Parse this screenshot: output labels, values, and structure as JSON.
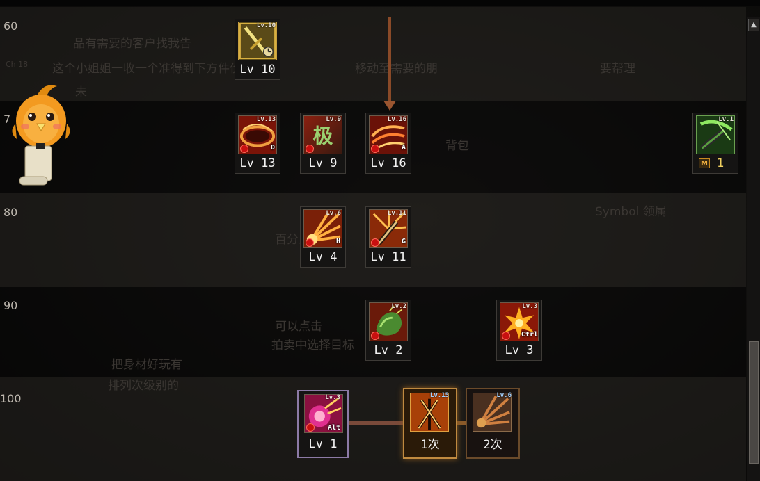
{
  "background_text": {
    "line1": "品有需要的客户找我告",
    "line2": "这个小姐姐一收一个准得到下方件价钱",
    "line3": "移动至需要的朋",
    "tail": "未",
    "right1": "要帮理",
    "right2": "Symbol 领属",
    "mid1": "背包",
    "mid2": "百分比",
    "lower1": "可以点击",
    "lower2": "拍卖中选择目标",
    "lower3": "把身材好玩有",
    "lower4": "排列次级别的",
    "left_small": "Ch 18"
  },
  "rows": [
    {
      "label": "60"
    },
    {
      "label": "7"
    },
    {
      "label": "80"
    },
    {
      "label": "90"
    },
    {
      "label": "100"
    }
  ],
  "skills": {
    "s60a": {
      "tag": "Lv.10",
      "caption": "Lv 10",
      "hotkey": ""
    },
    "s70a": {
      "tag": "Lv.13",
      "caption": "Lv 13",
      "hotkey": "D"
    },
    "s70b": {
      "tag": "Lv.9",
      "caption": "Lv 9",
      "hotkey": "",
      "glyph": "极"
    },
    "s70c": {
      "tag": "Lv.16",
      "caption": "Lv 16",
      "hotkey": "A"
    },
    "s70d": {
      "tag": "Lv.1",
      "caption": "1",
      "badge": "M"
    },
    "s80a": {
      "tag": "Lv.6",
      "caption": "Lv 4",
      "hotkey": "H"
    },
    "s80b": {
      "tag": "Lv.11",
      "caption": "Lv 11",
      "hotkey": "G"
    },
    "s90a": {
      "tag": "Lv.2",
      "caption": "Lv 2",
      "hotkey": ""
    },
    "s90b": {
      "tag": "Lv.3",
      "caption": "Lv 3",
      "hotkey": "Ctrl"
    },
    "s100a": {
      "tag": "Lv.3",
      "caption": "Lv 1",
      "hotkey": "Alt"
    },
    "s100b": {
      "tag": "Lv.15",
      "caption": "1次"
    },
    "s100c": {
      "tag": "Lv.6",
      "caption": "2次"
    }
  },
  "colors": {
    "arrow": "#8a4a28",
    "connector": "#7a4a3a",
    "selected_border": "#c08a40"
  },
  "scrollbar": {
    "up_icon": "▲",
    "position_pct": 75
  }
}
